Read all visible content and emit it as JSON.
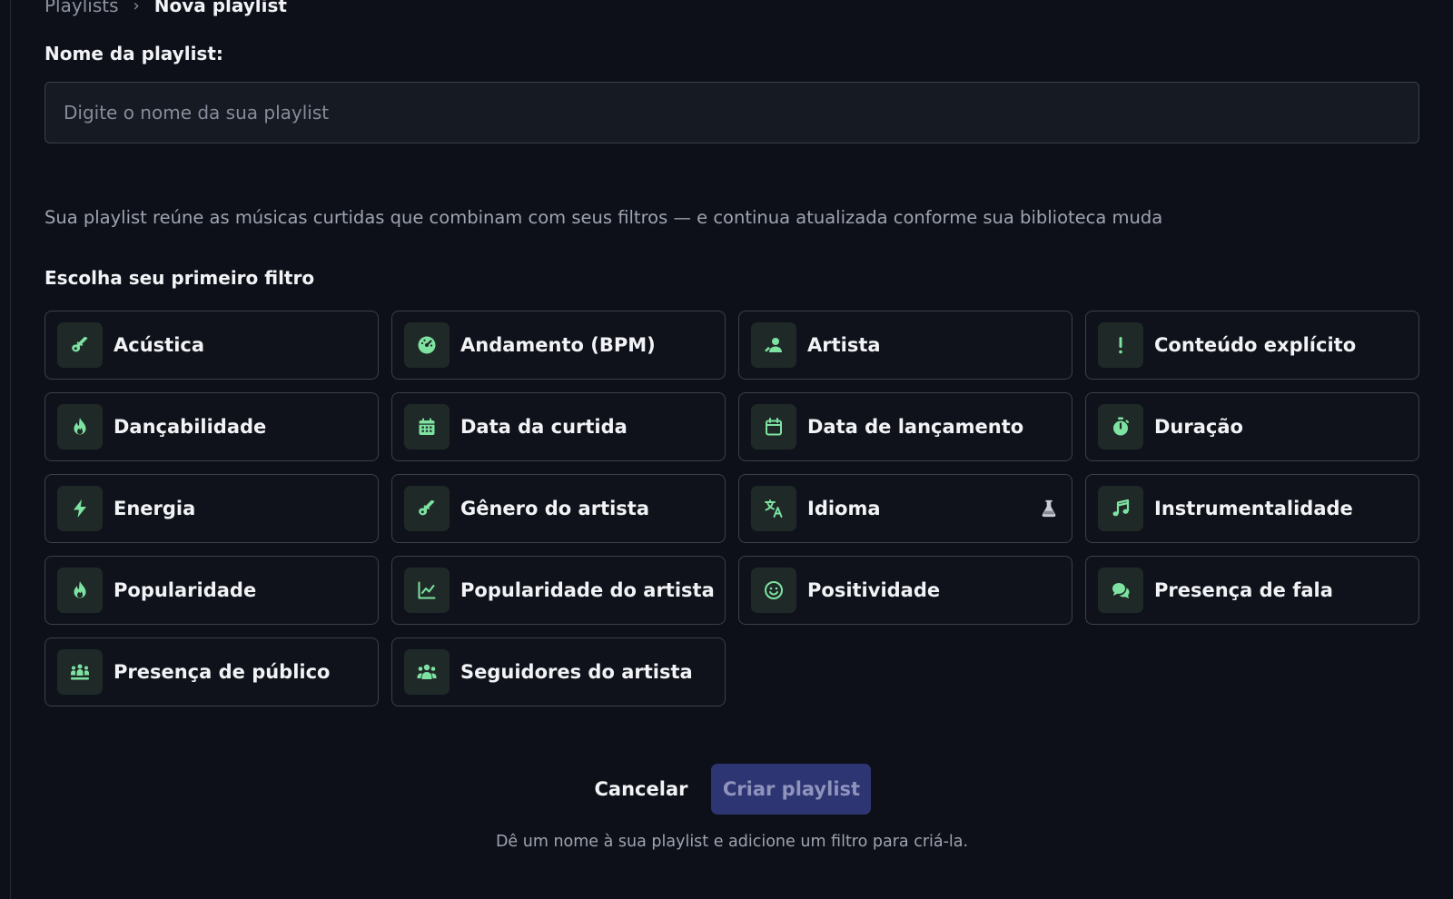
{
  "breadcrumb": {
    "parent": "Playlists",
    "separator": "›",
    "current": "Nova playlist"
  },
  "form": {
    "name_label": "Nome da playlist:",
    "name_placeholder": "Digite o nome da sua playlist",
    "name_value": ""
  },
  "description": "Sua playlist reúne as músicas curtidas que combinam com seus filtros — e continua atualizada conforme sua biblioteca muda",
  "filters": {
    "title": "Escolha seu primeiro filtro",
    "items": [
      {
        "label": "Acústica",
        "icon": "guitar-icon"
      },
      {
        "label": "Andamento (BPM)",
        "icon": "gauge-icon"
      },
      {
        "label": "Artista",
        "icon": "artist-icon"
      },
      {
        "label": "Conteúdo explícito",
        "icon": "exclamation-icon"
      },
      {
        "label": "Dançabilidade",
        "icon": "flame-icon"
      },
      {
        "label": "Data da curtida",
        "icon": "calendar-filled-icon"
      },
      {
        "label": "Data de lançamento",
        "icon": "calendar-outline-icon"
      },
      {
        "label": "Duração",
        "icon": "stopwatch-icon"
      },
      {
        "label": "Energia",
        "icon": "bolt-icon"
      },
      {
        "label": "Gênero do artista",
        "icon": "guitar-icon"
      },
      {
        "label": "Idioma",
        "icon": "translate-icon",
        "badge": "flask-icon"
      },
      {
        "label": "Instrumentalidade",
        "icon": "music-note-icon"
      },
      {
        "label": "Popularidade",
        "icon": "flame-icon"
      },
      {
        "label": "Popularidade do artista",
        "icon": "chart-line-icon"
      },
      {
        "label": "Positividade",
        "icon": "smile-icon"
      },
      {
        "label": "Presença de fala",
        "icon": "speech-bubbles-icon"
      },
      {
        "label": "Presença de público",
        "icon": "audience-icon"
      },
      {
        "label": "Seguidores do artista",
        "icon": "users-icon"
      }
    ]
  },
  "actions": {
    "cancel_label": "Cancelar",
    "create_label": "Criar playlist"
  },
  "hint": "Dê um nome à sua playlist e adicione um filtro para criá-la.",
  "colors": {
    "background": "#0d1018",
    "accent_green": "#7ee2a1",
    "icon_bg": "#1f2a28",
    "primary_button": "#2e3573",
    "primary_button_text": "#8f94bd"
  }
}
